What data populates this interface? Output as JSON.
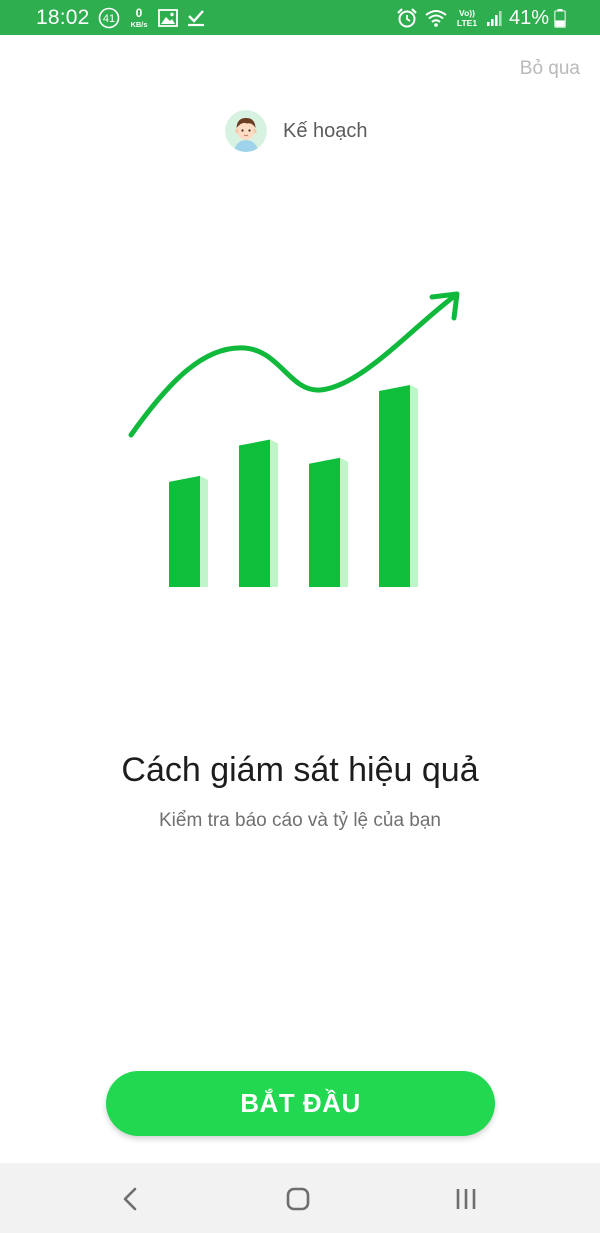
{
  "status_bar": {
    "time": "18:02",
    "notification_count": "41",
    "net_speed_value": "0",
    "net_speed_unit": "KB/s",
    "network_label_top": "Vo))",
    "network_label_bottom": "LTE1",
    "battery_text": "41%",
    "battery_level": 0.41,
    "background_color": "#2eae4f",
    "icons": [
      "notification-badge-icon",
      "image-icon",
      "check-icon",
      "alarm-icon",
      "wifi-icon",
      "signal-icon",
      "battery-icon"
    ]
  },
  "header": {
    "skip_label": "Bỏ qua",
    "title": "Kế hoạch",
    "avatar_icon": "boy-avatar-icon"
  },
  "illustration": {
    "icon": "growth-chart-icon",
    "bar_color": "#0fbf3c",
    "bar_shade_color": "#bff5c8",
    "bar_levels": [
      0.55,
      0.73,
      0.64,
      1.0
    ]
  },
  "content": {
    "headline": "Cách giám sát hiệu quả",
    "subtitle": "Kiểm tra báo cáo và tỷ lệ của bạn"
  },
  "actions": {
    "start_label": "BẮT ĐẦU",
    "start_color": "#22d851"
  },
  "nav_bar": {
    "icons": [
      "back-icon",
      "home-icon",
      "recent-apps-icon"
    ]
  }
}
